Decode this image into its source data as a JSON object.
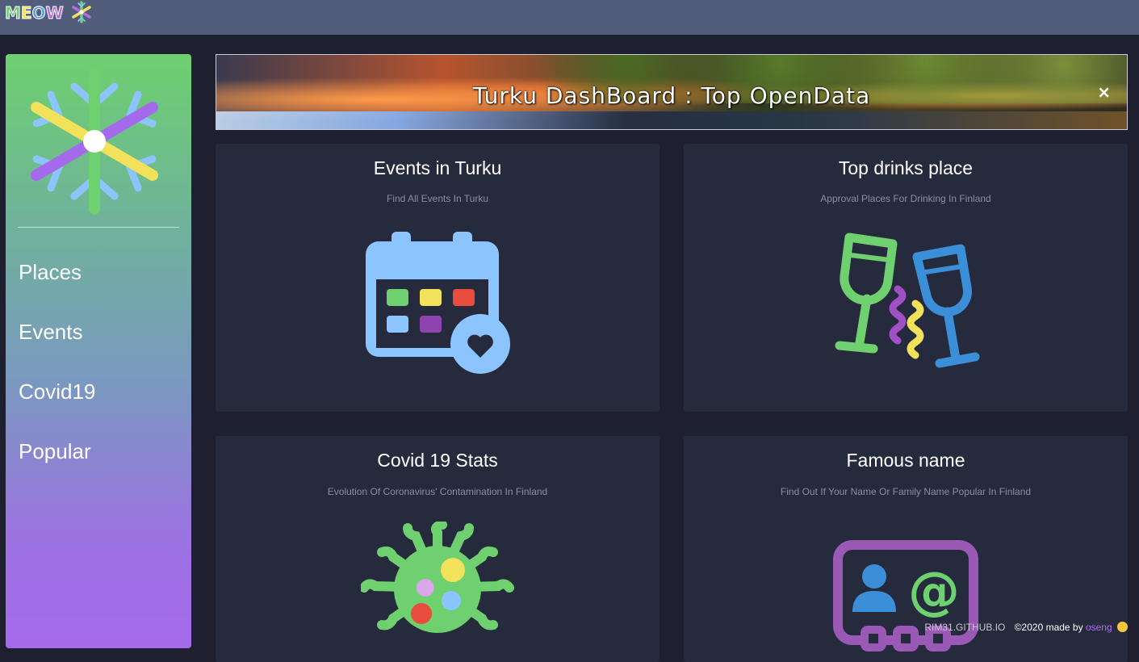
{
  "header": {
    "logo_letters": [
      "M",
      "E",
      "O",
      "W"
    ],
    "logo_colors": [
      "#6ed06f",
      "#f2e15a",
      "#5aa0f0",
      "#b36be0"
    ]
  },
  "sidebar": {
    "items": [
      {
        "label": "Places"
      },
      {
        "label": "Events"
      },
      {
        "label": "Covid19"
      },
      {
        "label": "Popular"
      }
    ]
  },
  "banner": {
    "title": "Turku DashBoard : Top OpenData",
    "close_label": "×"
  },
  "cards": [
    {
      "title": "Events in Turku",
      "subtitle": "Find All Events In Turku",
      "icon": "calendar-heart-icon"
    },
    {
      "title": "Top drinks place",
      "subtitle": "Approval Places For Drinking In Finland",
      "icon": "cheers-glasses-icon"
    },
    {
      "title": "Covid 19 Stats",
      "subtitle": "Evolution Of Coronavirus' Contamination In Finland",
      "icon": "virus-icon"
    },
    {
      "title": "Famous name",
      "subtitle": "Find Out If Your Name Or Family Name Popular In Finland",
      "icon": "contact-card-icon"
    }
  ],
  "footer": {
    "site": "RIM31.GITHUB.IO",
    "copyright": "©2020 made by",
    "author": "oseng"
  },
  "colors": {
    "topbar": "#525d7c",
    "background": "#1e2030",
    "card": "#262a3d",
    "green": "#6ed06f",
    "yellow": "#f2e15a",
    "blue": "#8cc4ff",
    "purple": "#a56aec",
    "red": "#e74c3c"
  }
}
